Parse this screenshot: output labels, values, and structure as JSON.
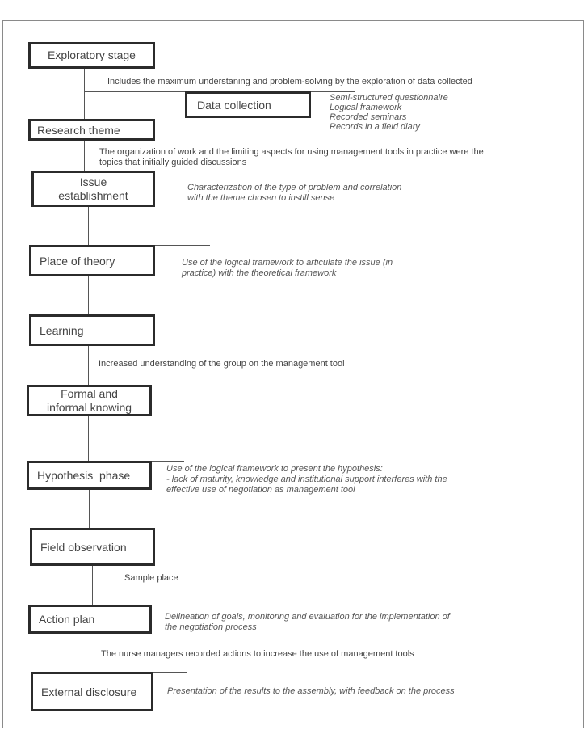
{
  "diagram": {
    "steps": [
      {
        "label": "Exploratory stage",
        "note": "Includes the maximum understaning and problem-solving by the exploration of data collected"
      },
      {
        "label": "Data collection",
        "items": [
          "Semi-structured questionnaire",
          "Logical framework",
          "Recorded seminars",
          "Records in a field diary"
        ]
      },
      {
        "label": "Research theme",
        "note_lines": [
          "The organization of work and the limiting aspects for using management tools in practice were the",
          "topics that initially guided discussions"
        ]
      },
      {
        "label_lines": [
          "Issue",
          "establishment"
        ],
        "note_lines": [
          "Characterization of the type of problem and correlation",
          "with  the theme chosen to instill sense"
        ]
      },
      {
        "label": "Place of theory",
        "note_lines": [
          "Use of the logical framework to articulate the issue (in",
          "practice) with  the theoretical framework"
        ]
      },
      {
        "label": "Learning",
        "note": "Increased understanding of the group on the management tool"
      },
      {
        "label_lines": [
          "Formal and",
          "informal knowing"
        ]
      },
      {
        "label": "Hypothesis  phase",
        "note_lines": [
          "Use of the logical framework to present the hypothesis:",
          "- lack of maturity, knowledge and institutional support interferes with the",
          "effective use of negotiation as management tool"
        ]
      },
      {
        "label": "Field observation",
        "note": "Sample place"
      },
      {
        "label": "Action plan",
        "note_lines": [
          "Delineation of goals, monitoring and evaluation for the implementation of",
          "the negotiation process"
        ],
        "after_note": "The nurse managers recorded actions to increase the use of management tools"
      },
      {
        "label": "External disclosure",
        "note": "Presentation of the results to the assembly, with feedback on the process"
      }
    ]
  }
}
